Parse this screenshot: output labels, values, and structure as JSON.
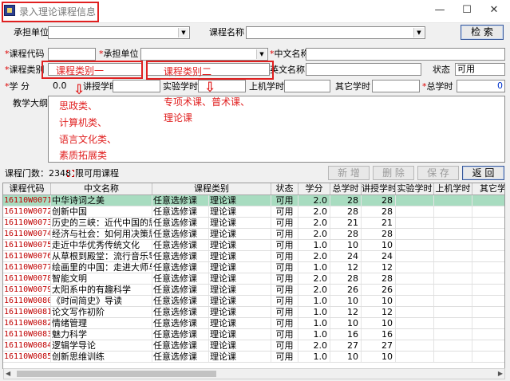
{
  "window": {
    "title": "录入理论课程信息",
    "controls": [
      "—",
      "☐",
      "✕"
    ]
  },
  "search": {
    "dept_label": "承担单位",
    "course_name_label": "课程名称",
    "search_button": "检 索"
  },
  "form": {
    "code_label": "课程代码",
    "dept_label": "承担单位",
    "cn_name_label": "中文名称",
    "type_label": "课程类别",
    "en_name_label": "英文名称",
    "status_label": "状态",
    "status_value": "可用",
    "credit_label": "学  分",
    "credit_value": "0.0",
    "lecture_hours_label": "讲授学时",
    "lab_hours_label": "实验学时",
    "computer_hours_label": "上机学时",
    "other_hours_label": "其它学时",
    "total_hours_label": "总学时",
    "total_hours_value": "0",
    "outline_label": "教学大纲"
  },
  "annotations": {
    "type1_box": "课程类别一",
    "type2_box": "课程类别二",
    "type1_options": [
      "思政类、",
      "计算机类、",
      "语言文化类、",
      "素质拓展类"
    ],
    "type2_options": [
      "专项术课、普术课、",
      "理论课"
    ],
    "arrow_glyph": "⇩"
  },
  "toolbar": {
    "count_text": "课程门数：2348",
    "legend_label": "限可用课程",
    "new_button": "新 增",
    "delete_button": "删 除",
    "save_button": "保 存",
    "back_button": "返 回"
  },
  "table": {
    "columns": [
      "课程代码",
      "中文名称",
      "课程类别",
      "状态",
      "学分",
      "总学时",
      "讲授学时",
      "实验学时",
      "上机学时",
      "其它学"
    ],
    "rows": [
      [
        "16110W0071",
        "中华诗词之美",
        "任意选修课",
        "理论课",
        "可用",
        "2.0",
        "28",
        "28"
      ],
      [
        "16110W0072",
        "创新中国",
        "任意选修课",
        "理论课",
        "可用",
        "2.0",
        "28",
        "28"
      ],
      [
        "16110W0073",
        "历史的三峡：近代中国的思",
        "任意选修课",
        "理论课",
        "可用",
        "2.0",
        "21",
        "21"
      ],
      [
        "16110W0074",
        "经济与社会：如何用决策思",
        "任意选修课",
        "理论课",
        "可用",
        "2.0",
        "28",
        "28"
      ],
      [
        "16110W0075",
        "走近中华优秀传统文化",
        "任意选修课",
        "理论课",
        "可用",
        "1.0",
        "10",
        "10"
      ],
      [
        "16110W0076",
        "从草根到殿堂：流行音乐导",
        "任意选修课",
        "理论课",
        "可用",
        "2.0",
        "24",
        "24"
      ],
      [
        "16110W0077",
        "绘画里的中国：走进大师与",
        "任意选修课",
        "理论课",
        "可用",
        "1.0",
        "12",
        "12"
      ],
      [
        "16110W0078",
        "智能文明",
        "任意选修课",
        "理论课",
        "可用",
        "2.0",
        "28",
        "28"
      ],
      [
        "16110W0079",
        "太阳系中的有趣科学",
        "任意选修课",
        "理论课",
        "可用",
        "2.0",
        "26",
        "26"
      ],
      [
        "16110W0080",
        "《时间简史》导读",
        "任意选修课",
        "理论课",
        "可用",
        "1.0",
        "10",
        "10"
      ],
      [
        "16110W0081",
        "论文写作初阶",
        "任意选修课",
        "理论课",
        "可用",
        "1.0",
        "12",
        "12"
      ],
      [
        "16110W0082",
        "情绪管理",
        "任意选修课",
        "理论课",
        "可用",
        "1.0",
        "10",
        "10"
      ],
      [
        "16110W0083",
        "魅力科学",
        "任意选修课",
        "理论课",
        "可用",
        "1.0",
        "16",
        "16"
      ],
      [
        "16110W0084",
        "逻辑学导论",
        "任意选修课",
        "理论课",
        "可用",
        "2.0",
        "27",
        "27"
      ],
      [
        "16110W0085",
        "创新思维训练",
        "任意选修课",
        "理论课",
        "可用",
        "1.0",
        "10",
        "10"
      ]
    ]
  },
  "colors": {
    "annotation_red": "#e02020",
    "selected_row": "#a8dcc0",
    "code_red": "#c00000"
  }
}
